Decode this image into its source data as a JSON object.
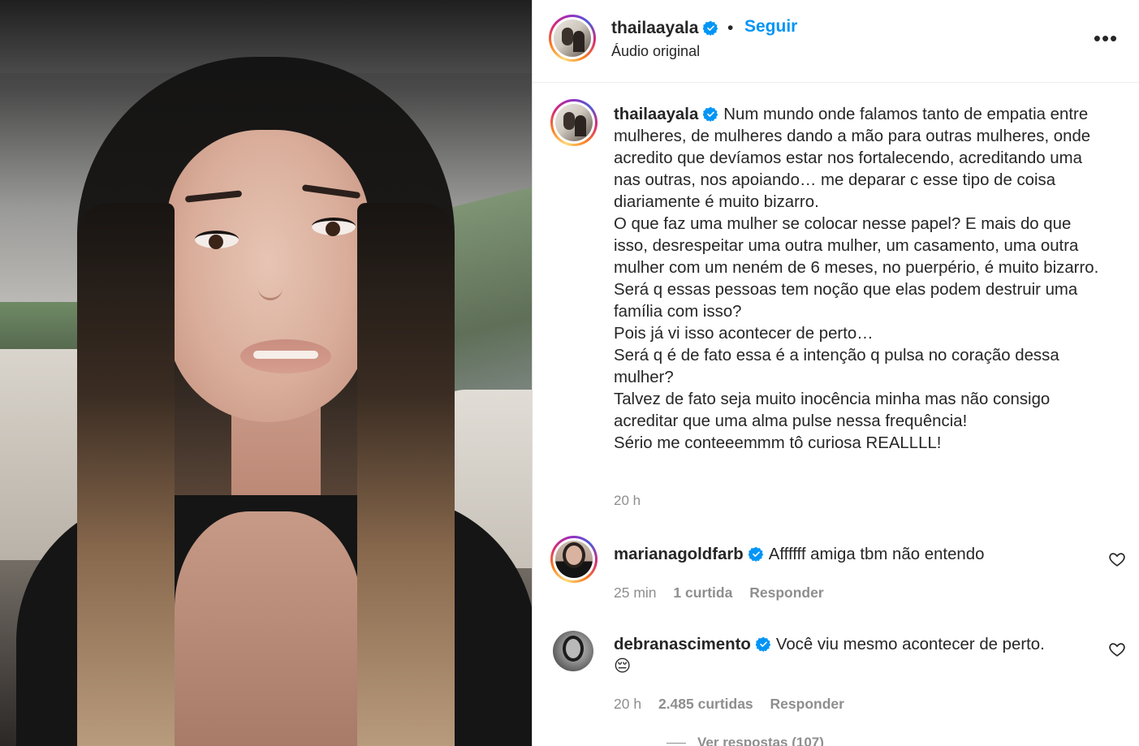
{
  "post": {
    "author": "thailaayala",
    "audio": "Áudio original",
    "follow_label": "Seguir",
    "dot": "•",
    "more_icon": "more-options-icon",
    "caption_author": "thailaayala",
    "caption_text": "Num mundo onde falamos tanto de empatia entre mulheres, de mulheres dando a mão para outras mulheres, onde acredito que devíamos estar nos fortalecendo, acreditando uma nas outras, nos apoiando… me deparar c esse tipo de coisa diariamente é muito bizarro.\nO que faz uma mulher se colocar nesse papel? E mais do que isso, desrespeitar uma outra mulher, um casamento, uma outra mulher com um neném de 6 meses, no puerpério, é muito bizarro.\nSerá q essas pessoas tem noção que elas podem destruir uma família com isso?\nPois já vi isso acontecer de perto…\nSerá q é de fato essa é a intenção q pulsa no coração dessa mulher?\nTalvez de fato seja muito inocência minha mas não consigo acreditar que uma alma pulse nessa frequência!\nSério me conteeemmm tô curiosa REALLLL!",
    "caption_time": "20 h"
  },
  "comments": [
    {
      "username": "marianagoldfarb",
      "text": "Affffff amiga tbm não entendo",
      "time": "25 min",
      "likes": "1 curtida",
      "reply_label": "Responder"
    },
    {
      "username": "debranascimento",
      "text": "Você viu mesmo acontecer de perto.",
      "emoji": "😔",
      "time": "20 h",
      "likes": "2.485 curtidas",
      "reply_label": "Responder"
    }
  ],
  "view_replies": "Ver respostas (107)",
  "colors": {
    "accent": "#0095f6",
    "verified": "#0095f6",
    "muted": "#8e8e8e",
    "text": "#262626"
  }
}
